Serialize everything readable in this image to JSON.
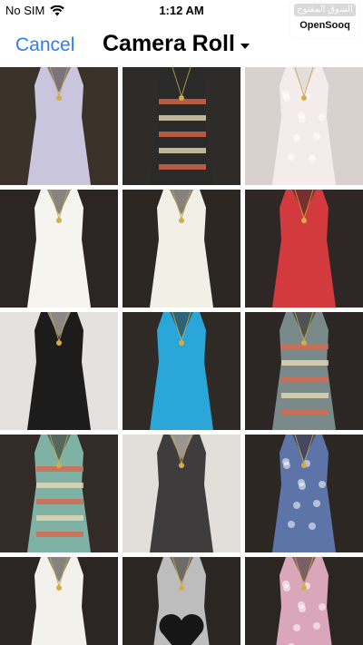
{
  "status_bar": {
    "carrier": "No SIM",
    "time": "1:12 AM"
  },
  "watermark": {
    "arabic_text": "السوق المفتوح",
    "brand": "OpenSooq"
  },
  "nav": {
    "cancel_label": "Cancel",
    "title": "Camera Roll"
  },
  "photos": [
    {
      "name": "photo-1",
      "color": "#c9c5dc",
      "bg": "#3a3129",
      "pattern": "plain"
    },
    {
      "name": "photo-2",
      "color": "#2a2a2a",
      "bg": "#2f2b28",
      "pattern": "print"
    },
    {
      "name": "photo-3",
      "color": "#f4eceb",
      "bg": "#d8d1cd",
      "pattern": "floral"
    },
    {
      "name": "photo-4",
      "color": "#f6f4ee",
      "bg": "#2b2624",
      "pattern": "plain"
    },
    {
      "name": "photo-5",
      "color": "#f2efe6",
      "bg": "#2d2724",
      "pattern": "plain"
    },
    {
      "name": "photo-6",
      "color": "#d23a3d",
      "bg": "#2f2725",
      "pattern": "plain"
    },
    {
      "name": "photo-7",
      "color": "#1c1c1c",
      "bg": "#e4e1de",
      "pattern": "plain"
    },
    {
      "name": "photo-8",
      "color": "#2aa6d9",
      "bg": "#302a27",
      "pattern": "plain"
    },
    {
      "name": "photo-9",
      "color": "#7a8a8a",
      "bg": "#2c2725",
      "pattern": "print"
    },
    {
      "name": "photo-10",
      "color": "#7fb1a4",
      "bg": "#332b27",
      "pattern": "print"
    },
    {
      "name": "photo-11",
      "color": "#3e3c3d",
      "bg": "#e2ded9",
      "pattern": "plain"
    },
    {
      "name": "photo-12",
      "color": "#5d74a8",
      "bg": "#2d2724",
      "pattern": "floral"
    },
    {
      "name": "photo-13",
      "color": "#f3f1ec",
      "bg": "#2b2623",
      "pattern": "plain"
    },
    {
      "name": "photo-14",
      "color": "#bdbdbd",
      "bg": "#2c2623",
      "pattern": "heart"
    },
    {
      "name": "photo-15",
      "color": "#d9a7b9",
      "bg": "#2c2623",
      "pattern": "floral"
    }
  ]
}
